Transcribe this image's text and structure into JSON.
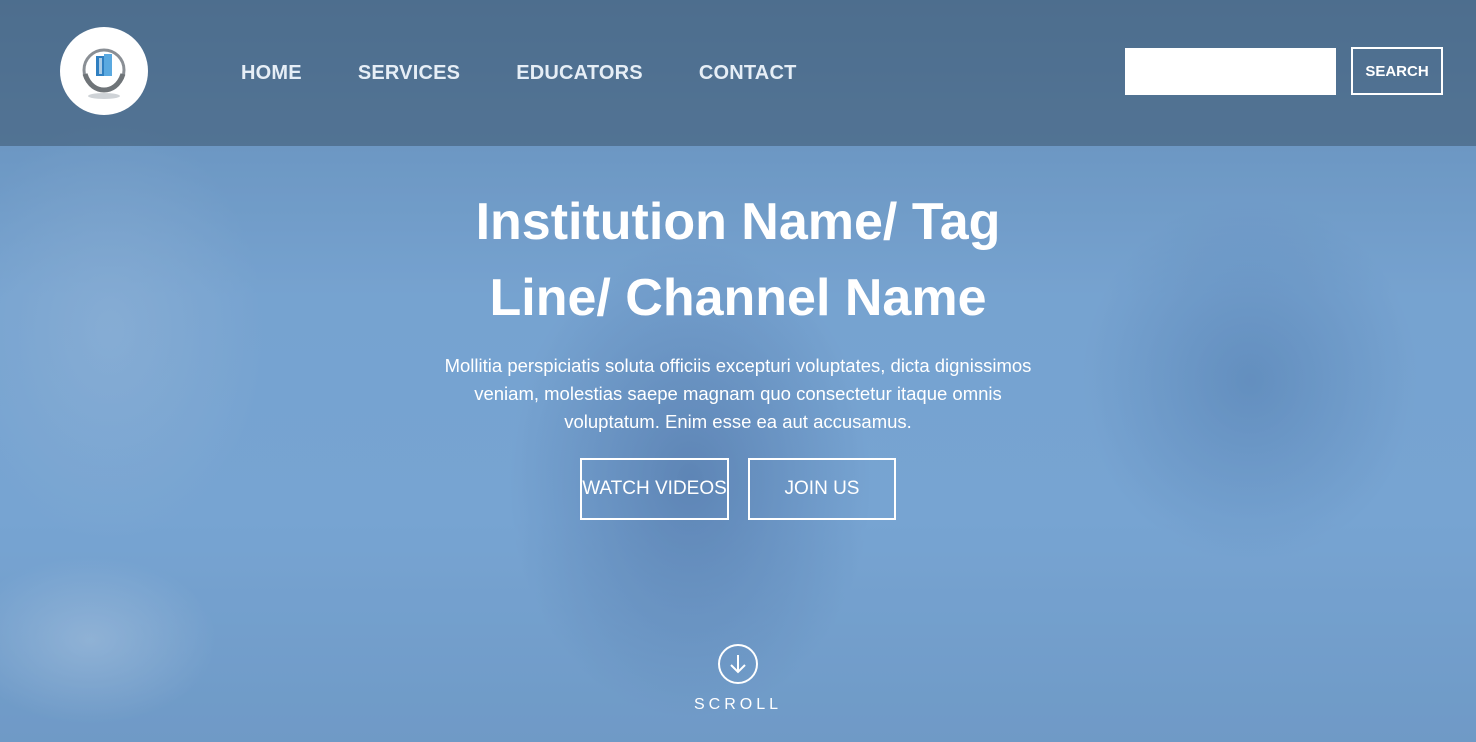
{
  "nav": {
    "items": [
      "HOME",
      "SERVICES",
      "EDUCATORS",
      "CONTACT"
    ]
  },
  "search": {
    "placeholder": "",
    "value": "",
    "button_label": "SEARCH"
  },
  "hero": {
    "title_line1": "Institution Name/ Tag",
    "title_line2": "Line/ Channel Name",
    "description": "Mollitia perspiciatis soluta officiis excepturi voluptates, dicta dignissimos veniam, molestias saepe magnam quo consectetur itaque omnis voluptatum. Enim esse ea aut accusamus.",
    "buttons": {
      "watch": "WATCH VIDEOS",
      "join": "JOIN US"
    },
    "scroll_label": "SCROLL"
  },
  "icons": {
    "logo": "book-hands-logo-icon",
    "scroll": "arrow-down-circle-icon"
  },
  "colors": {
    "overlay_blue": "#6f9bc6",
    "header_dark": "#3c556e",
    "text": "#ffffff"
  }
}
